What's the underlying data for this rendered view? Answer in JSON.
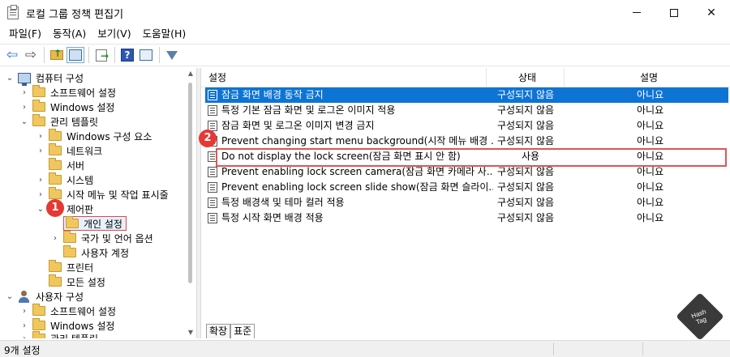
{
  "window": {
    "title": "로컬 그룹 정책 편집기"
  },
  "menu": [
    "파일(F)",
    "동작(A)",
    "보기(V)",
    "도움말(H)"
  ],
  "tree": {
    "computer_config": "컴퓨터 구성",
    "software_settings": "소프트웨어 설정",
    "windows_settings": "Windows 설정",
    "admin_templates": "관리 템플릿",
    "windows_components": "Windows 구성 요소",
    "network": "네트워크",
    "server": "서버",
    "system": "시스템",
    "start_menu": "시작 메뉴 및 작업 표시줄",
    "control_panel": "제어판",
    "personalization": "개인 설정",
    "regional": "국가 및 언어 옵션",
    "user_accounts": "사용자 계정",
    "printers": "프린터",
    "all_settings": "모든 설정",
    "user_config": "사용자 구성",
    "u_software_settings": "소프트웨어 설정",
    "u_windows_settings": "Windows 설정",
    "u_admin_templates": "관리 템플릿"
  },
  "list": {
    "columns": [
      "설정",
      "상태",
      "설명"
    ],
    "rows": [
      {
        "name": "잠금 화면 배경 동작 금지",
        "state": "구성되지 않음",
        "comment": "아니요",
        "selected": true
      },
      {
        "name": "특정 기본 잠금 화면 및 로그온 이미지 적용",
        "state": "구성되지 않음",
        "comment": "아니요"
      },
      {
        "name": "잠금 화면 및 로그온 이미지 변경 금지",
        "state": "구성되지 않음",
        "comment": "아니요"
      },
      {
        "name": "Prevent changing start menu background(시작 메뉴 배경 ...",
        "state": "구성되지 않음",
        "comment": "아니요"
      },
      {
        "name": "Do not display the lock screen(잠금 화면 표시 안 함)",
        "state": "사용",
        "comment": "아니요"
      },
      {
        "name": "Prevent enabling lock screen camera(잠금 화면 카메라 사...",
        "state": "구성되지 않음",
        "comment": "아니요"
      },
      {
        "name": "Prevent enabling lock screen slide show(잠금 화면 슬라이...",
        "state": "구성되지 않음",
        "comment": "아니요"
      },
      {
        "name": "특정 배경색 및 테마 컬러 적용",
        "state": "구성되지 않음",
        "comment": "아니요"
      },
      {
        "name": "특정 시작 화면 배경 적용",
        "state": "구성되지 않음",
        "comment": "아니요"
      }
    ]
  },
  "tabs": [
    "확장",
    "표준"
  ],
  "status": {
    "text": "9개 설정"
  },
  "badges": [
    "1",
    "2"
  ],
  "watermark": {
    "line1": "Hash",
    "line2": "Tag"
  },
  "colors": {
    "selection": "#0e74d4",
    "highlight_border": "#e05555",
    "badge": "#e53935"
  }
}
